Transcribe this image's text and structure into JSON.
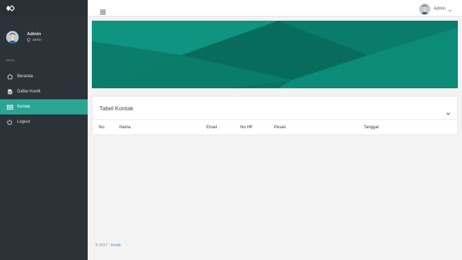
{
  "sidebar": {
    "brand_icon": "diamond-logo-icon",
    "profile": {
      "name": "Admin",
      "role": "admin",
      "role_icon": "location-pin-icon"
    },
    "section_title": "MAIN",
    "items": [
      {
        "label": "Beranda",
        "icon": "home-icon",
        "active": false
      },
      {
        "label": "Daftar Kredit",
        "icon": "file-icon",
        "active": false
      },
      {
        "label": "Kontak",
        "icon": "table-icon",
        "active": true
      },
      {
        "label": "Logout",
        "icon": "power-icon",
        "active": false
      }
    ]
  },
  "topbar": {
    "menu_icon": "hamburger-menu-icon",
    "user_name": "Admin",
    "caret_icon": "chevron-down-icon"
  },
  "card": {
    "title": "Tabel Kontak",
    "toggle_icon": "chevron-down-icon",
    "columns": [
      "No.",
      "Nama",
      "Email",
      "No HP",
      "Pesan",
      "Tanggal"
    ]
  },
  "footer": {
    "copyright": "© 2017",
    "link_label": "Kredit"
  },
  "colors": {
    "sidebar_bg": "#2b3338",
    "active_item": "#2aa594",
    "banner_teal": "#0b8775",
    "link_blue": "#3a8ed4"
  }
}
